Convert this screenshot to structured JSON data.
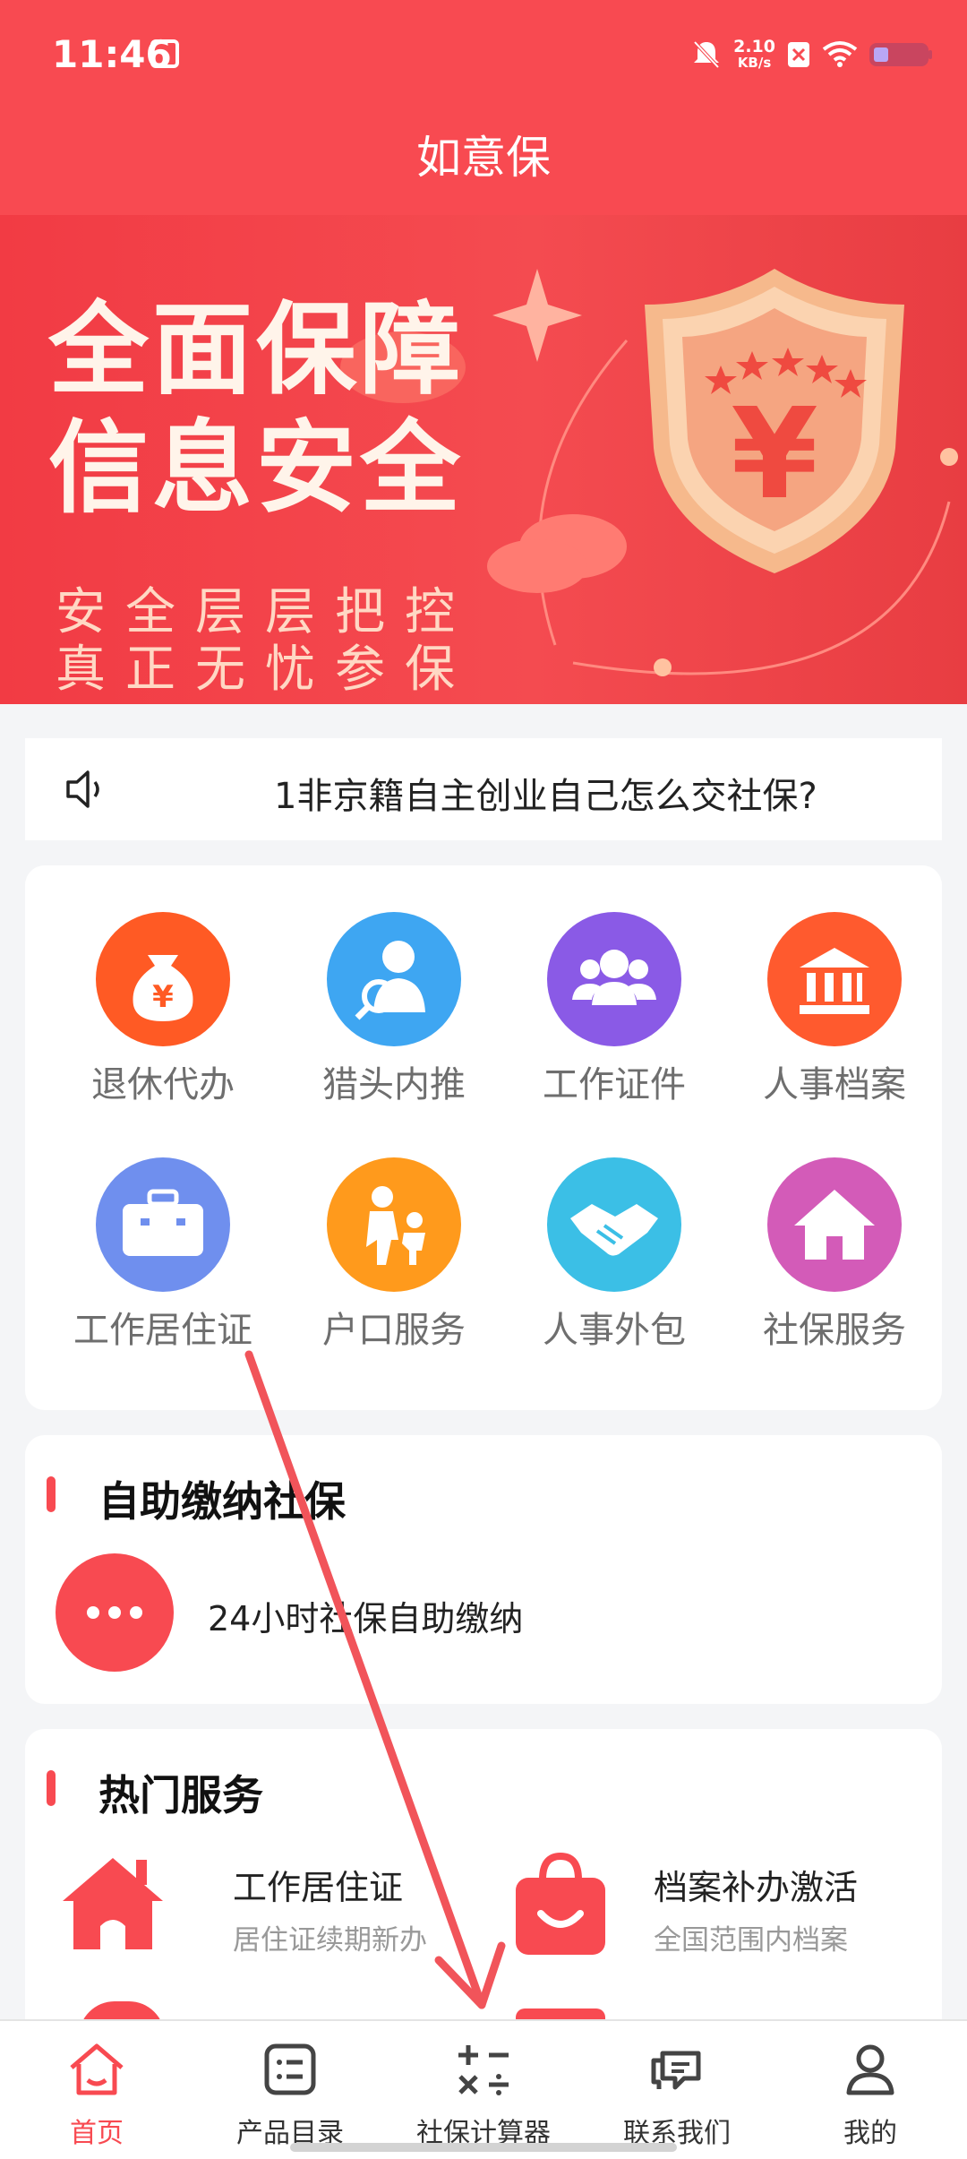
{
  "status_bar": {
    "time": "11:46",
    "speed_value": "2.10",
    "speed_unit": "KB/s"
  },
  "header": {
    "title": "如意保"
  },
  "banner": {
    "headline_line1": "全面保障",
    "headline_line2": "信息安全",
    "sub_line1": "安全层层把控",
    "sub_line2": "真正无忧参保",
    "shield_symbol": "¥"
  },
  "notice": {
    "text": "1非京籍自主创业自己怎么交社保?"
  },
  "services": [
    {
      "label": "退休代办",
      "color": "#ff5a24",
      "icon": "money-bag-icon"
    },
    {
      "label": "猎头内推",
      "color": "#3ea6f2",
      "icon": "headhunter-icon"
    },
    {
      "label": "工作证件",
      "color": "#8a5ae6",
      "icon": "people-group-icon"
    },
    {
      "label": "人事档案",
      "color": "#ff5a2e",
      "icon": "bank-building-icon"
    },
    {
      "label": "工作居住证",
      "color": "#6f8fee",
      "icon": "briefcase-icon"
    },
    {
      "label": "户口服务",
      "color": "#ff9a1c",
      "icon": "family-icon"
    },
    {
      "label": "人事外包",
      "color": "#3bbfe6",
      "icon": "handshake-icon"
    },
    {
      "label": "社保服务",
      "color": "#d35bb8",
      "icon": "house-icon"
    }
  ],
  "self_pay": {
    "title": "自助缴纳社保",
    "item_label": "24小时社保自助缴纳"
  },
  "hot_services": {
    "title": "热门服务",
    "items": [
      {
        "title": "工作居住证",
        "subtitle": "居住证续期新办"
      },
      {
        "title": "档案补办激活",
        "subtitle": "全国范围内档案"
      }
    ]
  },
  "tabbar": {
    "tabs": [
      {
        "label": "首页"
      },
      {
        "label": "产品目录"
      },
      {
        "label": "社保计算器"
      },
      {
        "label": "联系我们"
      },
      {
        "label": "我的"
      }
    ]
  },
  "colors": {
    "brand": "#f84a51",
    "text_muted": "#6e6e6e"
  }
}
